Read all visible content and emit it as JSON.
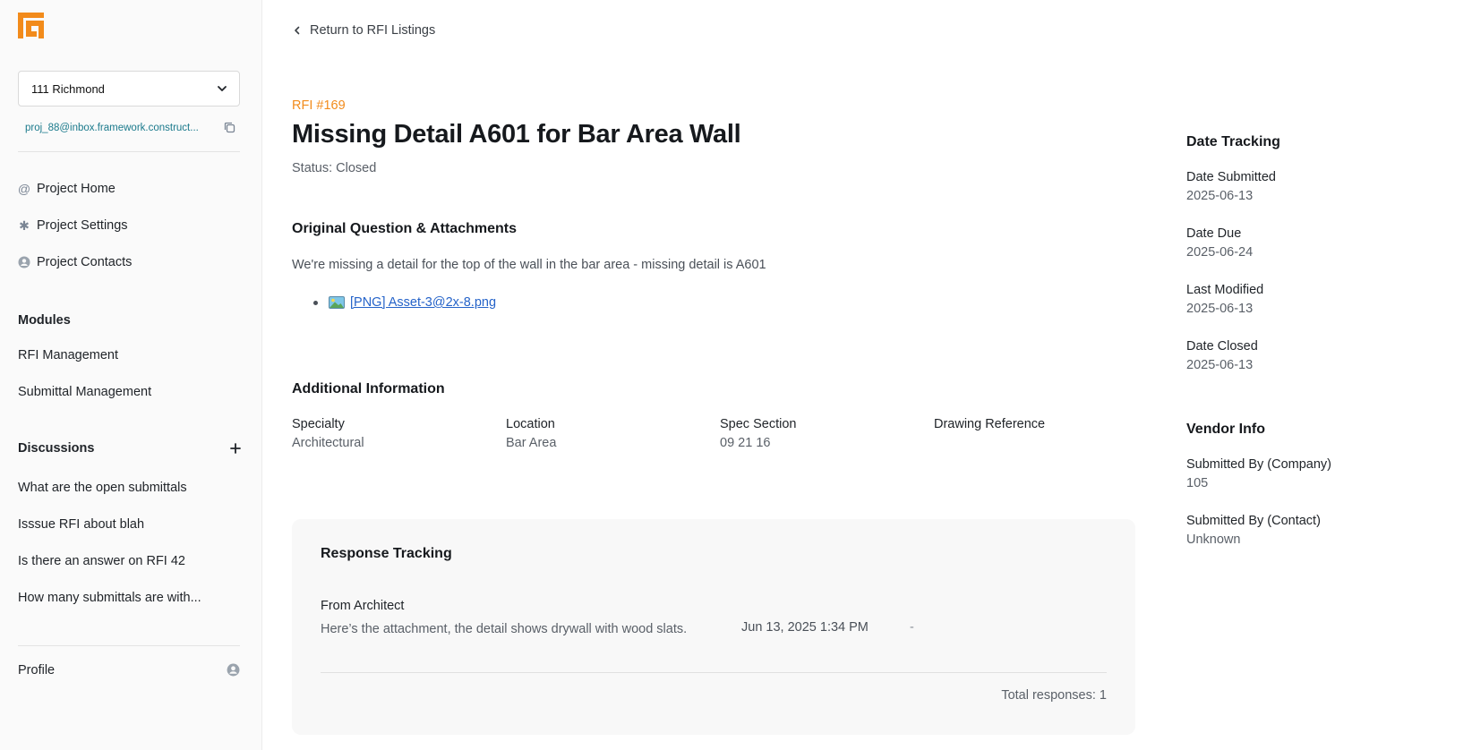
{
  "colors": {
    "accent": "#f28b1b",
    "link": "#2563c9",
    "email": "#1b7a8c"
  },
  "sidebar": {
    "project": "111 Richmond",
    "email": "proj_88@inbox.framework.construct...",
    "nav": [
      {
        "label": "Project Home",
        "icon": "at-icon"
      },
      {
        "label": "Project Settings",
        "icon": "asterisk-icon"
      },
      {
        "label": "Project Contacts",
        "icon": "user-circle-icon"
      }
    ],
    "modules_title": "Modules",
    "modules": [
      "RFI Management",
      "Submittal Management"
    ],
    "discussions_title": "Discussions",
    "discussions": [
      "What are the open submittals",
      "Isssue RFI about blah",
      "Is there an answer on RFI 42",
      "How many submittals are with..."
    ],
    "profile": "Profile"
  },
  "main": {
    "back_label": "Return to RFI Listings",
    "rfi_number": "RFI #169",
    "title": "Missing Detail A601 for Bar Area Wall",
    "status": "Status: Closed",
    "question_heading": "Original Question & Attachments",
    "question": "We're missing a detail for the top of the wall in the bar area - missing detail is A601",
    "attachment": "[PNG] Asset-3@2x-8.png",
    "additional_heading": "Additional Information",
    "additional": [
      {
        "label": "Specialty",
        "value": "Architectural"
      },
      {
        "label": "Location",
        "value": "Bar Area"
      },
      {
        "label": "Spec Section",
        "value": "09 21 16"
      },
      {
        "label": "Drawing Reference",
        "value": ""
      }
    ],
    "response": {
      "heading": "Response Tracking",
      "from": "From Architect",
      "text": "Here’s the attachment, the detail shows drywall with wood slats.",
      "date": "Jun 13, 2025 1:34 PM",
      "dash": "-",
      "total": "Total responses: 1"
    }
  },
  "right": {
    "dates_heading": "Date Tracking",
    "dates": [
      {
        "label": "Date Submitted",
        "value": "2025-06-13"
      },
      {
        "label": "Date Due",
        "value": "2025-06-24"
      },
      {
        "label": "Last Modified",
        "value": "2025-06-13"
      },
      {
        "label": "Date Closed",
        "value": "2025-06-13"
      }
    ],
    "vendor_heading": "Vendor Info",
    "vendor": [
      {
        "label": "Submitted By (Company)",
        "value": "105"
      },
      {
        "label": "Submitted By (Contact)",
        "value": "Unknown"
      }
    ]
  }
}
